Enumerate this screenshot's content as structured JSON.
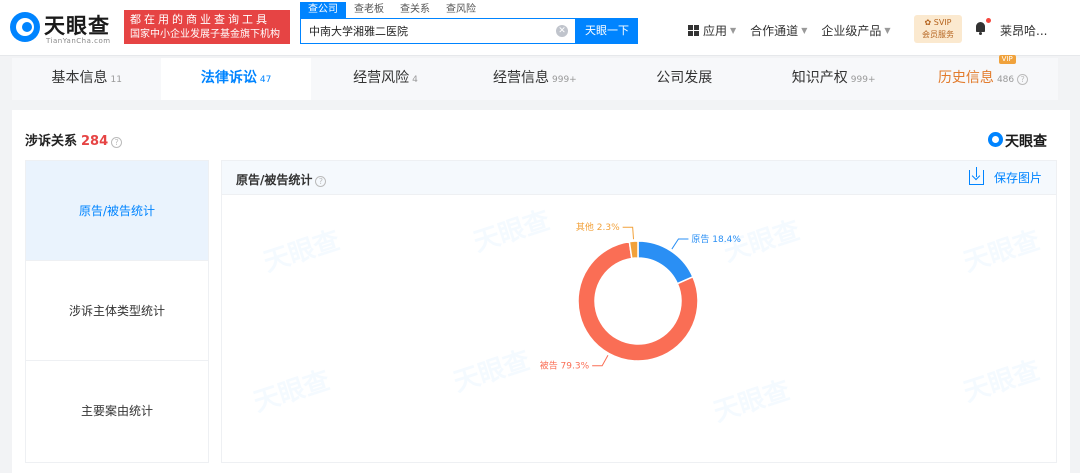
{
  "header": {
    "logo_name": "天眼查",
    "logo_sub": "TianYanCha.com",
    "slogan_line1": "都在用的商业查询工具",
    "slogan_line2": "国家中小企业发展子基金旗下机构",
    "search_tabs": [
      "查公司",
      "查老板",
      "查关系",
      "查风险"
    ],
    "search_value": "中南大学湘雅二医院",
    "search_button": "天眼一下",
    "nav": [
      {
        "label": "应用"
      },
      {
        "label": "合作通道"
      },
      {
        "label": "企业级产品"
      }
    ],
    "svip_line1": "✿ SVIP",
    "svip_line2": "会员服务",
    "user_name": "莱昂哈..."
  },
  "tabs": [
    {
      "label": "基本信息",
      "count": "11"
    },
    {
      "label": "法律诉讼",
      "count": "47"
    },
    {
      "label": "经营风险",
      "count": "4"
    },
    {
      "label": "经营信息",
      "count": "999+"
    },
    {
      "label": "公司发展",
      "count": ""
    },
    {
      "label": "知识产权",
      "count": "999+"
    },
    {
      "label": "历史信息",
      "count": "486"
    }
  ],
  "vip_tag": "VIP",
  "section": {
    "title": "涉诉关系",
    "count": "284",
    "brand": "天眼查"
  },
  "side_nav": [
    "原告/被告统计",
    "涉诉主体类型统计",
    "主要案由统计"
  ],
  "chart_card": {
    "title": "原告/被告统计",
    "save_label": "保存图片"
  },
  "colors": {
    "accent": "#0084ff",
    "plaintiff": "#2a8ff4",
    "defendant": "#fa6e55",
    "other": "#f2a13a"
  },
  "chart_data": {
    "type": "pie",
    "title": "原告/被告统计",
    "slices": [
      {
        "name": "原告",
        "value": 18.4,
        "label": "原告 18.4%",
        "color": "#2a8ff4"
      },
      {
        "name": "被告",
        "value": 79.3,
        "label": "被告 79.3%",
        "color": "#fa6e55"
      },
      {
        "name": "其他",
        "value": 2.3,
        "label": "其他 2.3%",
        "color": "#f2a13a"
      }
    ]
  }
}
